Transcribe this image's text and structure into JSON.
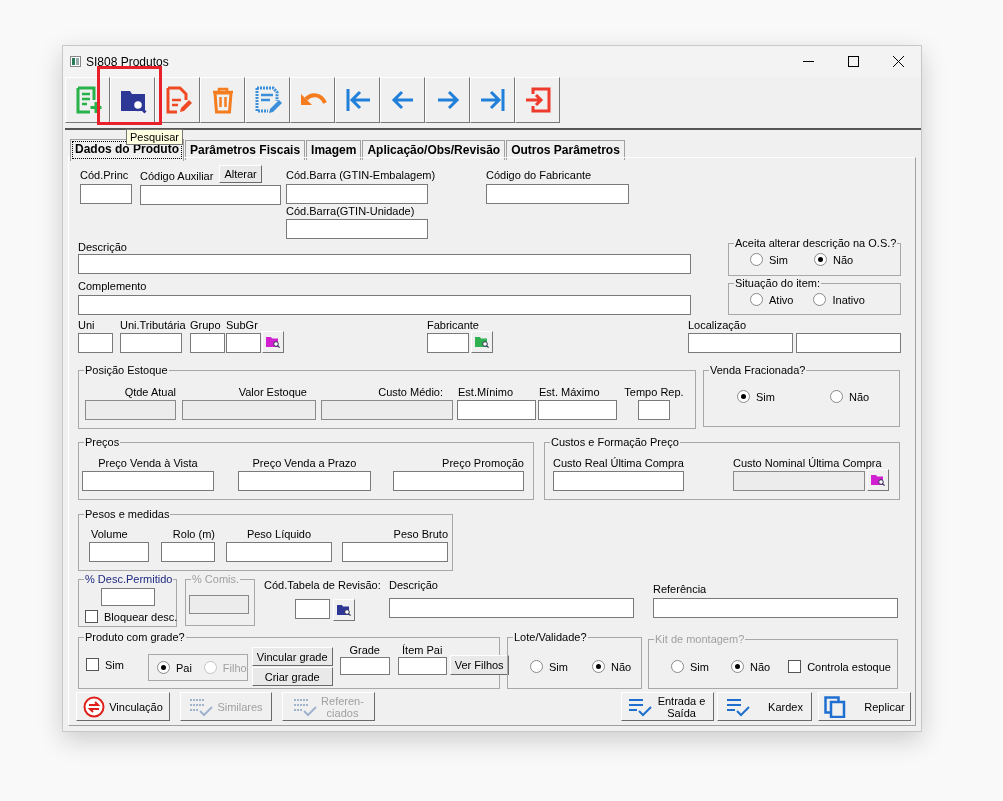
{
  "window": {
    "title": "SI808 Produtos"
  },
  "toolbar": {
    "buttons": [
      {
        "kind": "new",
        "highlighted": false
      },
      {
        "kind": "search",
        "highlighted": true
      },
      {
        "kind": "edit",
        "highlighted": false
      },
      {
        "kind": "delete",
        "highlighted": false
      },
      {
        "kind": "save",
        "highlighted": false
      },
      {
        "kind": "undo",
        "highlighted": false
      },
      {
        "kind": "first",
        "highlighted": false
      },
      {
        "kind": "prev",
        "highlighted": false
      },
      {
        "kind": "next",
        "highlighted": false
      },
      {
        "kind": "last",
        "highlighted": false
      },
      {
        "kind": "exit",
        "highlighted": false
      }
    ],
    "tooltip": "Pesquisar"
  },
  "tabs": [
    {
      "label": "Dados do Produto",
      "selected": true
    },
    {
      "label": "Parâmetros Fiscais",
      "selected": false
    },
    {
      "label": "Imagem",
      "selected": false
    },
    {
      "label": "Aplicação/Obs/Revisão",
      "selected": false
    },
    {
      "label": "Outros Parâmetros",
      "selected": false
    }
  ],
  "main": {
    "cod_princ": "Cód.Princ",
    "cod_aux": "Código Auxiliar",
    "alterar_button": "Alterar",
    "gtin_emb": "Cód.Barra (GTIN-Embalagem)",
    "gtin_uni": "Cód.Barra(GTIN-Unidade)",
    "cod_fab": "Código do Fabricante",
    "descricao": "Descrição",
    "complemento": "Complemento",
    "uni": "Uni",
    "uni_trib": "Uni.Tributária",
    "grupo": "Grupo",
    "subgr": "SubGr",
    "fabricante": "Fabricante",
    "localizacao": "Localização"
  },
  "aceita_alterar": {
    "title": "Aceita alterar descrição na O.S.?",
    "options": [
      {
        "label": "Sim",
        "selected": false
      },
      {
        "label": "Não",
        "selected": true
      }
    ]
  },
  "situacao": {
    "title": "Situação do item:",
    "options": [
      {
        "label": "Ativo",
        "selected": false
      },
      {
        "label": "Inativo",
        "selected": false
      }
    ]
  },
  "posicao_estoque": {
    "title": "Posição Estoque",
    "fields": [
      {
        "label": "Qtde Atual",
        "disabled": true
      },
      {
        "label": "Valor Estoque",
        "disabled": true
      },
      {
        "label": "Custo Médio:",
        "disabled": true
      },
      {
        "label": "Est.Mínimo",
        "disabled": false
      },
      {
        "label": "Est. Máximo",
        "disabled": false
      },
      {
        "label": "Tempo Rep.",
        "disabled": false
      }
    ]
  },
  "venda_fracionada": {
    "title": "Venda Fracionada?",
    "options": [
      {
        "label": "Sim",
        "selected": true
      },
      {
        "label": "Não",
        "selected": false
      }
    ]
  },
  "precos": {
    "title": "Preços",
    "fields": [
      {
        "label": "Preço Venda à Vista",
        "disabled": false
      },
      {
        "label": "Preço Venda a Prazo",
        "disabled": false
      },
      {
        "label": "Preço Promoção",
        "disabled": false
      }
    ]
  },
  "custos": {
    "title": "Custos e Formação Preço",
    "fields": [
      {
        "label": "Custo Real Última Compra",
        "disabled": false
      },
      {
        "label": "Custo Nominal Última Compra",
        "disabled": true
      }
    ]
  },
  "pesos": {
    "title": "Pesos e medidas",
    "fields": [
      {
        "label": "Volume",
        "disabled": false
      },
      {
        "label": "Rolo (m)",
        "disabled": false
      },
      {
        "label": "Peso Líquido",
        "disabled": false
      },
      {
        "label": "Peso Bruto",
        "disabled": false
      }
    ]
  },
  "desconto": {
    "title": "% Desc.Permitido",
    "checkbox": {
      "label": "Bloquear desc.",
      "checked": false
    }
  },
  "comissao": {
    "title": "% Comis.",
    "disabled": true
  },
  "revisao": {
    "tabela_label": "Cód.Tabela de Revisão:",
    "descricao_label": "Descrição",
    "referencia_label": "Referência"
  },
  "grade": {
    "title": "Produto com grade?",
    "sim": {
      "label": "Sim",
      "checked": false
    },
    "options": [
      {
        "label": "Pai",
        "selected": true,
        "disabled": false
      },
      {
        "label": "Filho",
        "selected": false,
        "disabled": true
      }
    ],
    "buttons": [
      "Vincular grade",
      "Criar grade"
    ],
    "grade_label": "Grade",
    "item_pai_label": "Ítem Pai",
    "ver_filhos": "Ver Filhos"
  },
  "lote": {
    "title": "Lote/Validade?",
    "options": [
      {
        "label": "Sim",
        "selected": false
      },
      {
        "label": "Não",
        "selected": true
      }
    ]
  },
  "kit": {
    "title": "Kit de montagem?",
    "disabled": true,
    "options": [
      {
        "label": "Sim",
        "selected": false
      },
      {
        "label": "Não",
        "selected": true
      }
    ],
    "checkbox": {
      "label": "Controla estoque",
      "checked": false
    }
  },
  "bottom_buttons": [
    {
      "kind": "link",
      "label": "Vinculação",
      "disabled": false
    },
    {
      "kind": "similar",
      "label": "Similares",
      "disabled": true
    },
    {
      "kind": "similar",
      "label": "Referen-\nciados",
      "disabled": true
    },
    {
      "kind": "list",
      "label": "Entrada e Saída",
      "disabled": false
    },
    {
      "kind": "list",
      "label": "Kardex",
      "disabled": false
    },
    {
      "kind": "copy",
      "label": "Replicar",
      "disabled": false
    }
  ]
}
